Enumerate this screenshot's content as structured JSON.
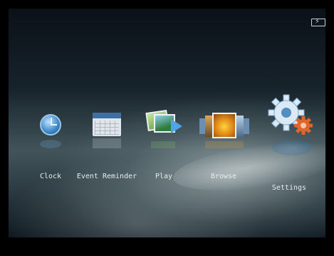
{
  "status": {
    "battery_icon": "battery-charging-icon"
  },
  "menu": {
    "items": [
      {
        "label": "Clock",
        "icon": "clock-icon"
      },
      {
        "label": "Event Reminder",
        "icon": "calendar-icon"
      },
      {
        "label": "Play",
        "icon": "slideshow-play-icon"
      },
      {
        "label": "Browse",
        "icon": "photo-filmstrip-icon"
      },
      {
        "label": "Settings",
        "icon": "settings-gear-icon"
      }
    ],
    "selected": "Settings"
  },
  "colors": {
    "accent": "#4fa3e6",
    "label": "#e6ecee",
    "gear_orange": "#e0652b"
  }
}
